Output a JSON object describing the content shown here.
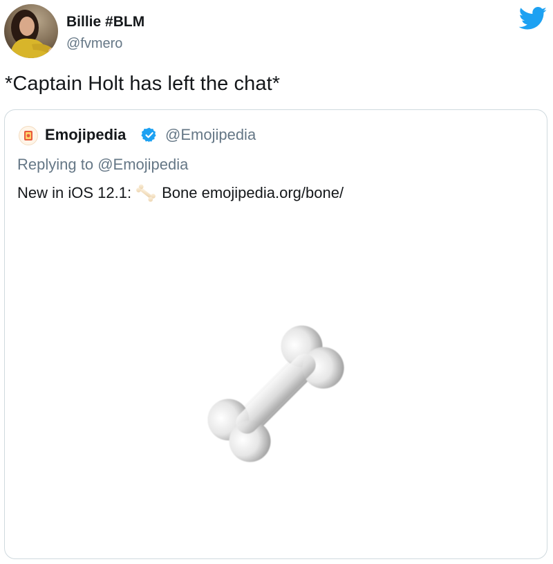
{
  "tweet": {
    "author": {
      "name": "Billie #BLM",
      "handle": "@fvmero"
    },
    "text": "*Captain Holt has left the chat*",
    "platform_icon": "twitter-bird-icon",
    "colors": {
      "brand_blue": "#1da1f2",
      "text": "#14171a",
      "secondary_text": "#657786",
      "border": "#cfd9de"
    }
  },
  "quoted_tweet": {
    "author": {
      "name": "Emojipedia",
      "handle": "@Emojipedia",
      "verified": true,
      "avatar_icon": "emojipedia-logo-icon"
    },
    "replying_prefix": "Replying to",
    "replying_to": "@Emojipedia",
    "text_before_emoji": "New in iOS 12.1:",
    "emoji_icon": "bone-emoji-icon",
    "text_after_emoji": "Bone",
    "link": "emojipedia.org/bone/",
    "media_icon": "bone-emoji-icon"
  }
}
